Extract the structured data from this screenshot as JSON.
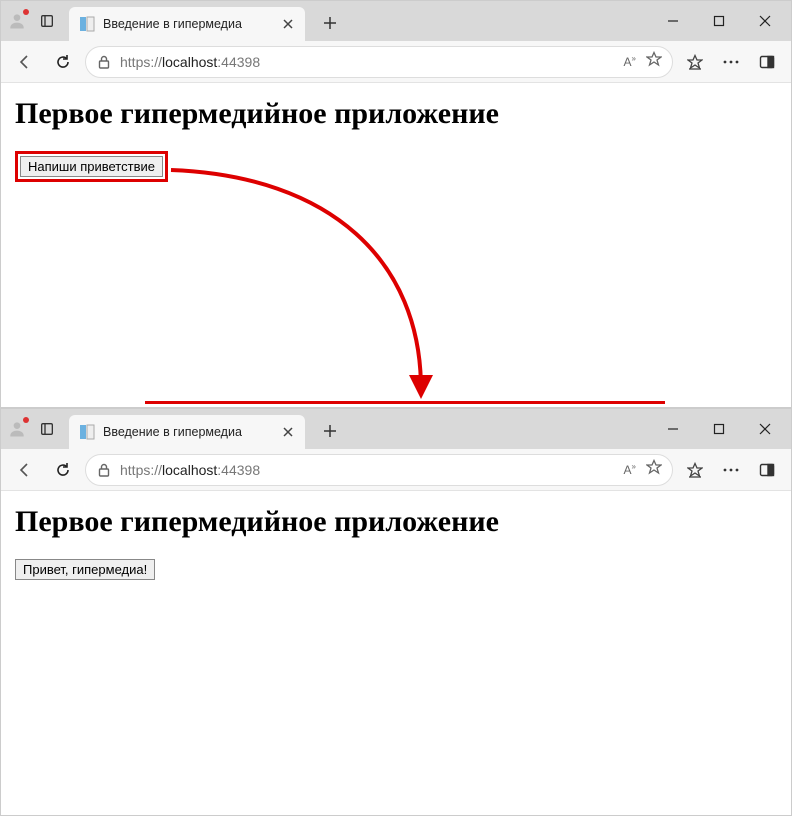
{
  "colors": {
    "annotation": "#d00"
  },
  "tab": {
    "title": "Введение в гипермедиа"
  },
  "address": {
    "protocol": "https://",
    "host": "localhost",
    "port": ":44398"
  },
  "pageTop": {
    "heading": "Первое гипермедийное приложение",
    "button_label": "Напиши приветствие"
  },
  "pageBottom": {
    "heading": "Первое гипермедийное приложение",
    "button_label": "Привет, гипермедиа!"
  }
}
